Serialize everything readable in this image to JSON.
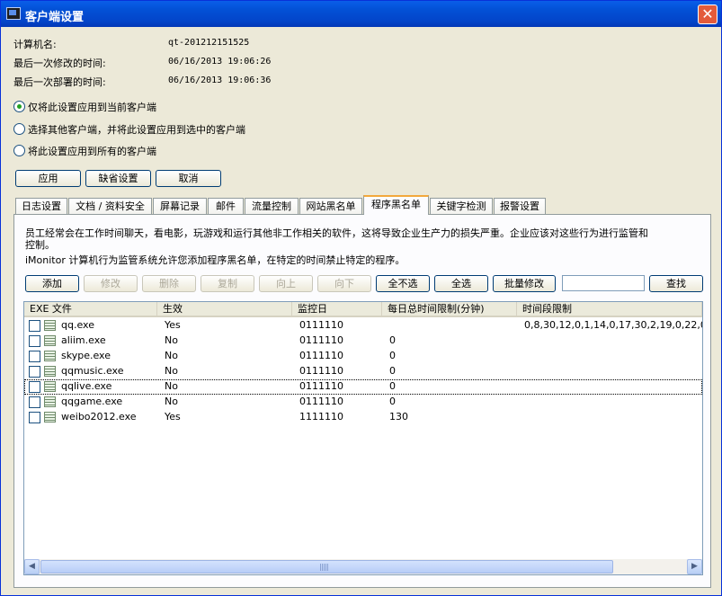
{
  "window": {
    "title": "客户端设置",
    "close_glyph": "✕"
  },
  "info": [
    {
      "label": "计算机名:",
      "value": "qt-201212151525"
    },
    {
      "label": "最后一次修改的时间:",
      "value": "06/16/2013 19:06:26"
    },
    {
      "label": "最后一次部署的时间:",
      "value": "06/16/2013 19:06:36"
    }
  ],
  "radios": [
    {
      "label": "仅将此设置应用到当前客户端",
      "checked": true
    },
    {
      "label": "选择其他客户端，并将此设置应用到选中的客户端",
      "checked": false
    },
    {
      "label": "将此设置应用到所有的客户端",
      "checked": false
    }
  ],
  "actions": {
    "apply": "应用",
    "default": "缺省设置",
    "cancel": "取消"
  },
  "tabs": [
    "日志设置",
    "文档 / 资料安全",
    "屏幕记录",
    "邮件",
    "流量控制",
    "网站黑名单",
    "程序黑名单",
    "关键字检测",
    "报警设置"
  ],
  "active_tab": 6,
  "panel": {
    "desc1": "员工经常会在工作时间聊天，看电影，玩游戏和运行其他非工作相关的软件，这将导致企业生产力的损失严重。企业应该对这些行为进行监管和",
    "desc2": "控制。",
    "desc3": "iMonitor 计算机行为监管系统允许您添加程序黑名单，在特定的时间禁止特定的程序。",
    "toolbar": {
      "add": "添加",
      "edit": "修改",
      "delete": "删除",
      "copy": "复制",
      "up": "向上",
      "down": "向下",
      "select_none": "全不选",
      "select_all": "全选",
      "batch_edit": "批量修改",
      "search_value": "",
      "find": "查找"
    },
    "columns": [
      "EXE 文件",
      "生效",
      "监控日",
      "每日总时间限制(分钟)",
      "时间段限制"
    ],
    "rows": [
      {
        "exe": "qq.exe",
        "enabled": "Yes",
        "days": "0111110",
        "limit": "",
        "periods": "0,8,30,12,0,1,14,0,17,30,2,19,0,22,0,"
      },
      {
        "exe": "aliim.exe",
        "enabled": "No",
        "days": "0111110",
        "limit": "0",
        "periods": ""
      },
      {
        "exe": "skype.exe",
        "enabled": "No",
        "days": "0111110",
        "limit": "0",
        "periods": ""
      },
      {
        "exe": "qqmusic.exe",
        "enabled": "No",
        "days": "0111110",
        "limit": "0",
        "periods": ""
      },
      {
        "exe": "qqlive.exe",
        "enabled": "No",
        "days": "0111110",
        "limit": "0",
        "periods": ""
      },
      {
        "exe": "qqgame.exe",
        "enabled": "No",
        "days": "0111110",
        "limit": "0",
        "periods": ""
      },
      {
        "exe": "weibo2012.exe",
        "enabled": "Yes",
        "days": "1111110",
        "limit": "130",
        "periods": ""
      }
    ]
  },
  "scrollbar": {
    "left_glyph": "◀",
    "right_glyph": "▶"
  }
}
